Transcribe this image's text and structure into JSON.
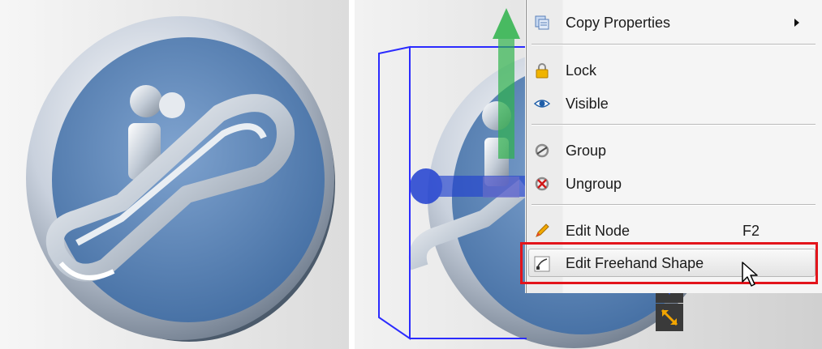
{
  "menu": {
    "items": [
      {
        "label": "Copy Properties",
        "icon": "copy-properties-icon",
        "has_submenu": true
      },
      {
        "label": "Lock",
        "icon": "lock-icon"
      },
      {
        "label": "Visible",
        "icon": "eye-icon"
      },
      {
        "label": "Group",
        "icon": "group-icon"
      },
      {
        "label": "Ungroup",
        "icon": "ungroup-icon"
      },
      {
        "label": "Edit Node",
        "icon": "pencil-icon",
        "shortcut": "F2"
      },
      {
        "label": "Edit Freehand Shape",
        "icon": "freehand-shape-icon",
        "highlighted": true
      }
    ]
  },
  "colors": {
    "highlight_border": "#e3141b",
    "emblem_blue": "#5b86b8",
    "selection_box": "#2b2bff",
    "gizmo_green": "#2db34a",
    "gizmo_blue": "#2040d0"
  },
  "icons": {
    "left_emblem": "escalator-emblem-icon",
    "cursor": "arrow-cursor-icon"
  }
}
